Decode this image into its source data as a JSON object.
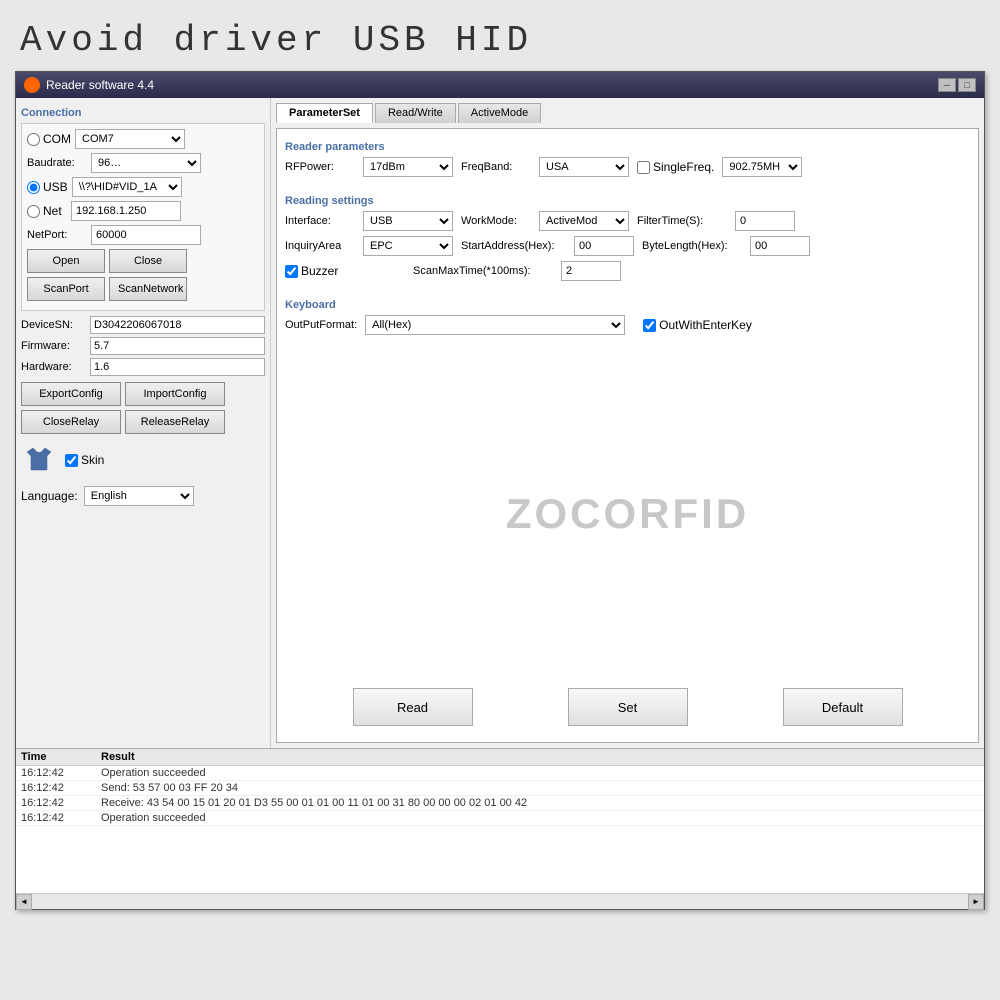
{
  "header": {
    "title": "Avoid driver USB HID"
  },
  "titlebar": {
    "icon": "●",
    "title": "Reader software 4.4",
    "minimize": "─",
    "maximize": "□"
  },
  "left": {
    "connection_label": "Connection",
    "com_label": "COM",
    "com_value": "COM7",
    "baudrate_label": "Baudrate:",
    "baudrate_value": "96…",
    "usb_label": "USB",
    "usb_value": "\\\\?\\HID#VID_1A",
    "net_label": "Net",
    "net_value": "192.168.1.250",
    "netport_label": "NetPort:",
    "netport_value": "60000",
    "open_btn": "Open",
    "close_btn": "Close",
    "scanport_btn": "ScanPort",
    "scannetwork_btn": "ScanNetwork",
    "devicesn_label": "DeviceSN:",
    "devicesn_value": "D3042206067018",
    "firmware_label": "Firmware:",
    "firmware_value": "5.7",
    "hardware_label": "Hardware:",
    "hardware_value": "1.6",
    "exportconfig_btn": "ExportConfig",
    "importconfig_btn": "ImportConfig",
    "closerelay_btn": "CloseRelay",
    "relayrelay_btn": "ReleaseRelay",
    "skin_label": "Skin",
    "language_label": "Language:",
    "language_value": "English"
  },
  "right": {
    "tabs": [
      "ParameterSet",
      "Read/Write",
      "ActiveMode"
    ],
    "active_tab": "ParameterSet",
    "reader_params_label": "Reader parameters",
    "rfpower_label": "RFPower:",
    "rfpower_value": "17dBm",
    "freqband_label": "FreqBand:",
    "freqband_value": "USA",
    "singlefreq_label": "SingleFreq.",
    "singlefreq_value": "902.75MH",
    "reading_settings_label": "Reading settings",
    "interface_label": "Interface:",
    "interface_value": "USB",
    "workmode_label": "WorkMode:",
    "workmode_value": "ActiveMod",
    "filtertime_label": "FilterTime(S):",
    "filtertime_value": "0",
    "inquiryarea_label": "InquiryArea",
    "inquiryarea_value": "EPC",
    "startaddress_label": "StartAddress(Hex):",
    "startaddress_value": "00",
    "bytelength_label": "ByteLength(Hex):",
    "bytelength_value": "00",
    "buzzer_label": "Buzzer",
    "scanmaxtime_label": "ScanMaxTime(*100ms):",
    "scanmaxtime_value": "2",
    "keyboard_label": "Keyboard",
    "outputformat_label": "OutPutFormat:",
    "outputformat_value": "All(Hex)",
    "outwithenterkey_label": "OutWithEnterKey",
    "watermark": "ZOCORFID",
    "read_btn": "Read",
    "set_btn": "Set",
    "default_btn": "Default"
  },
  "log": {
    "col_time": "Time",
    "col_result": "Result",
    "rows": [
      {
        "time": "16:12:42",
        "result": "Operation succeeded"
      },
      {
        "time": "16:12:42",
        "result": "Send: 53 57 00 03 FF 20 34"
      },
      {
        "time": "16:12:42",
        "result": "Receive: 43 54 00 15 01 20 01 D3 55 00 01 01 00 11 01 00 31 80 00 00 00 02 01 00 42"
      },
      {
        "time": "16:12:42",
        "result": "Operation succeeded"
      }
    ]
  }
}
